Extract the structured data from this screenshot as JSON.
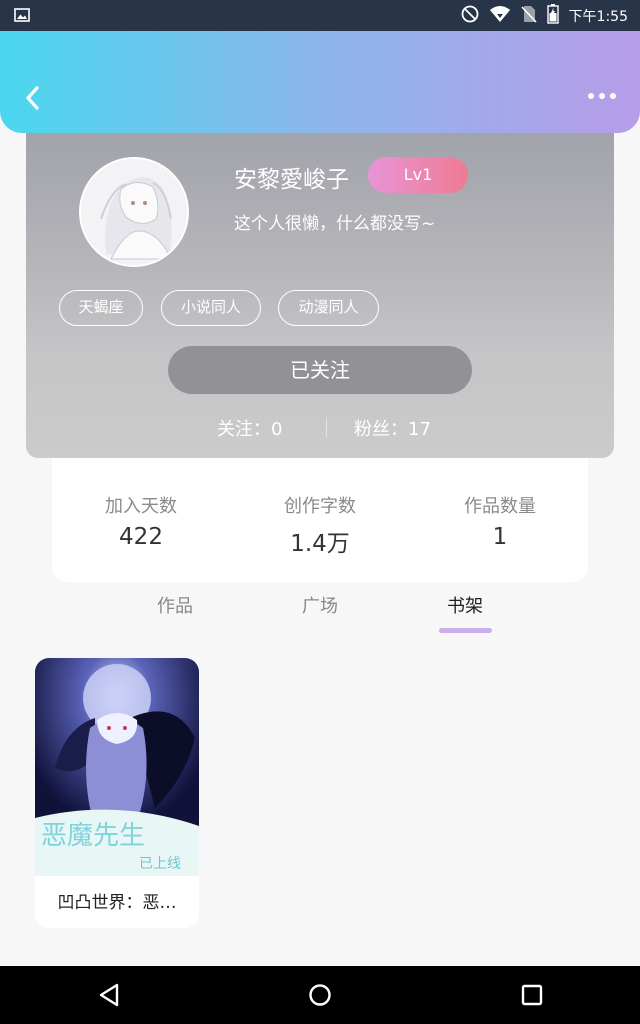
{
  "status_bar": {
    "time": "下午1:55",
    "icons": [
      "image-icon",
      "do-not-disturb-icon",
      "wifi-icon",
      "no-sim-icon",
      "battery-icon"
    ]
  },
  "header": {
    "back_icon": "chevron-left-icon",
    "more_icon": "more-horizontal-icon",
    "gradient": [
      "#4ad7ef",
      "#b79de9"
    ]
  },
  "profile": {
    "username": "安黎愛峻子",
    "level": "Lv1",
    "bio": "这个人很懒，什么都没写~",
    "tags": [
      "天蝎座",
      "小说同人",
      "动漫同人"
    ],
    "follow_button": "已关注",
    "following": "关注：0",
    "followers": "粉丝：17"
  },
  "stats": [
    {
      "label": "加入天数",
      "value": "422"
    },
    {
      "label": "创作字数",
      "value": "1.4万"
    },
    {
      "label": "作品数量",
      "value": "1"
    }
  ],
  "tabs": [
    {
      "label": "作品",
      "active": false
    },
    {
      "label": "广场",
      "active": false
    },
    {
      "label": "书架",
      "active": true
    }
  ],
  "bookshelf": [
    {
      "title": "凹凸世界：恶…",
      "cover_text": "恶魔先生",
      "cover_subtext": "已上线"
    }
  ],
  "nav_bar": {
    "icons": [
      "back-triangle-icon",
      "home-circle-icon",
      "recents-square-icon"
    ]
  },
  "colors": {
    "accent": "#c9aee8",
    "level_badge": [
      "#e794d7",
      "#ef7b92"
    ]
  }
}
